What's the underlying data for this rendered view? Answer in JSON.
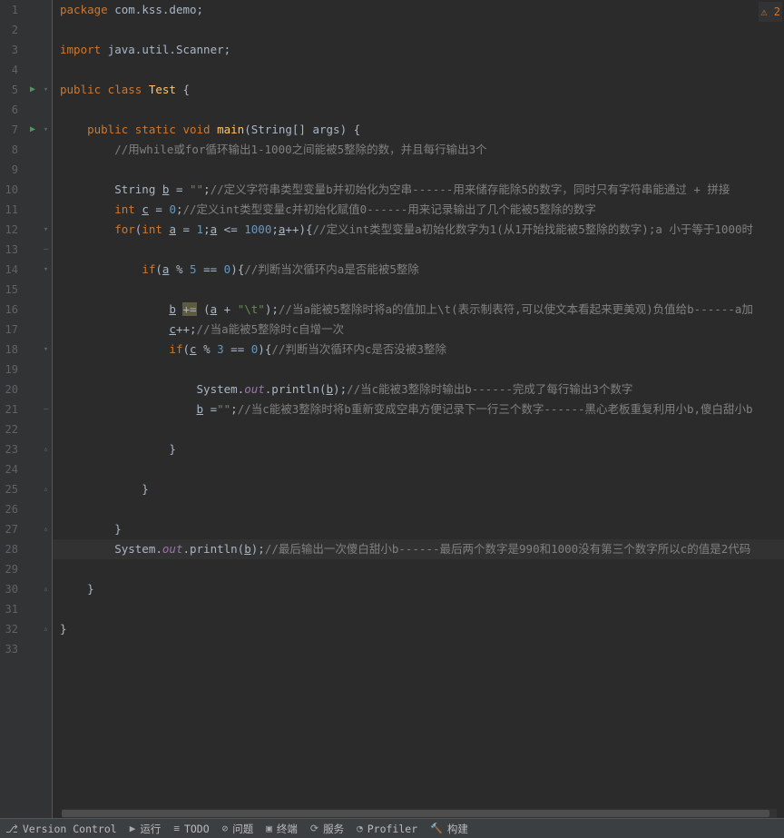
{
  "warning_count": "2",
  "line_count": 33,
  "run_lines": [
    5,
    7
  ],
  "fold_lines": [
    5,
    7,
    14,
    14,
    18,
    21,
    23,
    25,
    27,
    28
  ],
  "neg_fold": [
    13,
    14,
    15,
    16,
    17,
    18,
    21,
    23,
    25,
    27
  ],
  "code": [
    [
      [
        "kw",
        "package "
      ],
      [
        "",
        "com.kss.demo"
      ],
      [
        "",
        ";"
      ]
    ],
    [],
    [
      [
        "kw",
        "import "
      ],
      [
        "",
        "java.util.Scanner"
      ],
      [
        "",
        ";"
      ]
    ],
    [],
    [
      [
        "kw",
        "public class "
      ],
      [
        "fn",
        "Test "
      ],
      [
        "",
        "{"
      ]
    ],
    [],
    [
      [
        "",
        "    "
      ],
      [
        "kw",
        "public static void "
      ],
      [
        "fn",
        "main"
      ],
      [
        "",
        "("
      ],
      [
        "",
        "String"
      ],
      [
        "",
        "[] "
      ],
      [
        "param",
        "args"
      ],
      [
        "",
        ") {"
      ]
    ],
    [
      [
        "",
        "        "
      ],
      [
        "cmt",
        "//用while或for循环输出1-1000之间能被5整除的数，并且每行输出3个"
      ]
    ],
    [],
    [
      [
        "",
        "        String "
      ],
      [
        "var-u",
        "b"
      ],
      [
        "",
        " = "
      ],
      [
        "str",
        "\"\""
      ],
      [
        "",
        ";"
      ],
      [
        "cmt",
        "//定义字符串类型变量b并初始化为空串------用来储存能除5的数字，同时只有字符串能通过 + 拼接"
      ]
    ],
    [
      [
        "",
        "        "
      ],
      [
        "kw",
        "int "
      ],
      [
        "var-u",
        "c"
      ],
      [
        "",
        " = "
      ],
      [
        "num",
        "0"
      ],
      [
        "",
        ";"
      ],
      [
        "cmt",
        "//定义int类型变量c并初始化赋值0------用来记录输出了几个能被5整除的数字"
      ]
    ],
    [
      [
        "",
        "        "
      ],
      [
        "kw",
        "for"
      ],
      [
        "",
        "("
      ],
      [
        "kw",
        "int "
      ],
      [
        "var-u",
        "a"
      ],
      [
        "",
        " = "
      ],
      [
        "num",
        "1"
      ],
      [
        "",
        ";"
      ],
      [
        "var-u",
        "a"
      ],
      [
        "",
        " <= "
      ],
      [
        "num",
        "1000"
      ],
      [
        "",
        ";"
      ],
      [
        "var-u",
        "a"
      ],
      [
        "",
        "++){"
      ],
      [
        "cmt",
        "//定义int类型变量a初始化数字为1(从1开始找能被5整除的数字);a 小于等于1000时"
      ]
    ],
    [],
    [
      [
        "",
        "            "
      ],
      [
        "kw",
        "if"
      ],
      [
        "",
        "("
      ],
      [
        "var-u",
        "a"
      ],
      [
        "",
        " % "
      ],
      [
        "num",
        "5"
      ],
      [
        "",
        " == "
      ],
      [
        "num",
        "0"
      ],
      [
        "",
        "){"
      ],
      [
        "cmt",
        "//判断当次循环内a是否能被5整除"
      ]
    ],
    [],
    [
      [
        "",
        "                "
      ],
      [
        "var-u",
        "b"
      ],
      [
        "",
        " "
      ],
      [
        "hl-op",
        "+="
      ],
      [
        "",
        " ("
      ],
      [
        "var-u",
        "a"
      ],
      [
        "",
        " + "
      ],
      [
        "str",
        "\"\\t\""
      ],
      [
        "",
        ");"
      ],
      [
        "cmt",
        "//当a能被5整除时将a的值加上\\t(表示制表符,可以使文本看起来更美观)负值给b------a加"
      ]
    ],
    [
      [
        "",
        "                "
      ],
      [
        "var-u",
        "c"
      ],
      [
        "",
        "++;"
      ],
      [
        "cmt",
        "//当a能被5整除时c自增一次"
      ]
    ],
    [
      [
        "",
        "                "
      ],
      [
        "kw",
        "if"
      ],
      [
        "",
        "("
      ],
      [
        "var-u",
        "c"
      ],
      [
        "",
        " % "
      ],
      [
        "num",
        "3"
      ],
      [
        "",
        " == "
      ],
      [
        "num",
        "0"
      ],
      [
        "",
        "){"
      ],
      [
        "cmt",
        "//判断当次循环内c是否没被3整除"
      ]
    ],
    [],
    [
      [
        "",
        "                    System."
      ],
      [
        "fld",
        "out"
      ],
      [
        "",
        ".println("
      ],
      [
        "var-u",
        "b"
      ],
      [
        "",
        ");"
      ],
      [
        "cmt",
        "//当c能被3整除时输出b------完成了每行输出3个数字"
      ]
    ],
    [
      [
        "",
        "                    "
      ],
      [
        "var-u",
        "b"
      ],
      [
        "",
        " ="
      ],
      [
        "str",
        "\"\""
      ],
      [
        "",
        ";"
      ],
      [
        "cmt",
        "//当c能被3整除时将b重新变成空串方便记录下一行三个数字------黑心老板重复利用小b,傻白甜小b"
      ]
    ],
    [],
    [
      [
        "",
        "                }"
      ]
    ],
    [],
    [
      [
        "",
        "            }"
      ]
    ],
    [],
    [
      [
        "",
        "        }"
      ]
    ],
    [
      [
        "",
        "        System."
      ],
      [
        "fld",
        "out"
      ],
      [
        "",
        ".println("
      ],
      [
        "var-u",
        "b"
      ],
      [
        "",
        ");"
      ],
      [
        "cmt",
        "//最后输出一次傻白甜小b------最后两个数字是990和1000没有第三个数字所以c的值是2代码"
      ]
    ],
    [],
    [
      [
        "",
        "    }"
      ]
    ],
    [],
    [
      [
        "",
        "}"
      ]
    ],
    []
  ],
  "bottombar": {
    "version_control": "Version Control",
    "run": "运行",
    "todo": "TODO",
    "problems": "问题",
    "terminal": "终端",
    "services": "服务",
    "profiler": "Profiler",
    "build": "构建"
  }
}
